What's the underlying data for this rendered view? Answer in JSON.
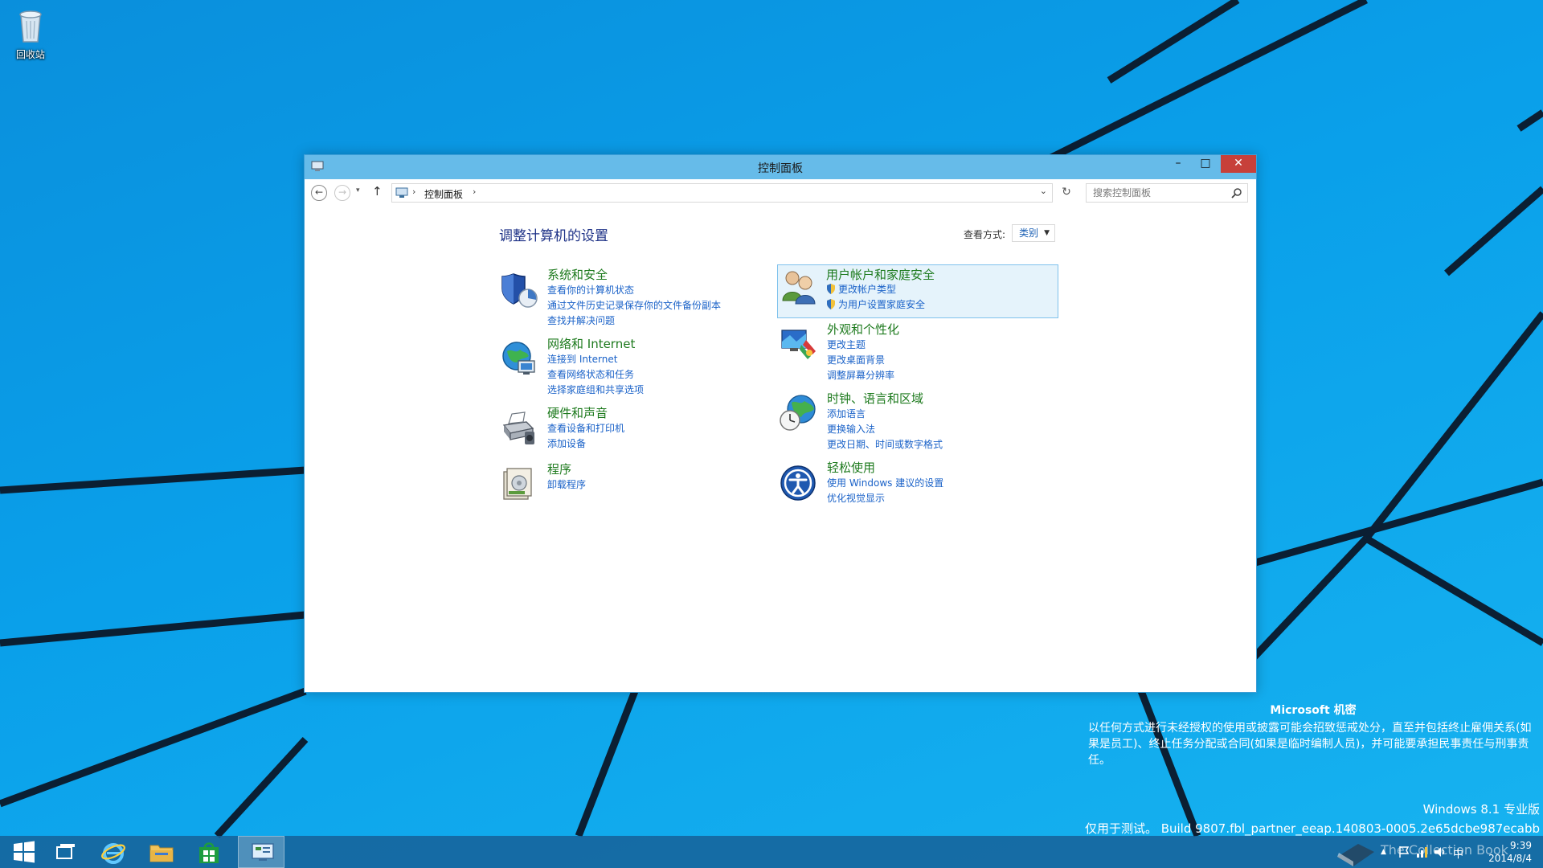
{
  "desktop": {
    "recycle_bin_label": "回收站"
  },
  "window": {
    "title": "控制面板",
    "controls": {
      "minimize": "–",
      "maximize": "□",
      "close": "✕"
    }
  },
  "navbar": {
    "back": "←",
    "forward": "→",
    "recent": "▾",
    "up": "↑",
    "address_crumb": "控制面板",
    "address_separator": "›",
    "dropdown": "⌄",
    "refresh": "↻",
    "search_placeholder": "搜索控制面板"
  },
  "content": {
    "heading": "调整计算机的设置",
    "view_by_label": "查看方式:",
    "view_by_value": "类别",
    "categories": [
      {
        "title": "系统和安全",
        "links": [
          "查看你的计算机状态",
          "通过文件历史记录保存你的文件备份副本",
          "查找并解决问题"
        ]
      },
      {
        "title": "网络和 Internet",
        "links": [
          "连接到 Internet",
          "查看网络状态和任务",
          "选择家庭组和共享选项"
        ]
      },
      {
        "title": "硬件和声音",
        "links": [
          "查看设备和打印机",
          "添加设备"
        ]
      },
      {
        "title": "程序",
        "links": [
          "卸载程序"
        ]
      },
      {
        "title": "用户帐户和家庭安全",
        "links": [
          "更改帐户类型",
          "为用户设置家庭安全"
        ]
      },
      {
        "title": "外观和个性化",
        "links": [
          "更改主题",
          "更改桌面背景",
          "调整屏幕分辨率"
        ]
      },
      {
        "title": "时钟、语言和区域",
        "links": [
          "添加语言",
          "更换输入法",
          "更改日期、时间或数字格式"
        ]
      },
      {
        "title": "轻松使用",
        "links": [
          "使用 Windows 建议的设置",
          "优化视觉显示"
        ]
      }
    ]
  },
  "watermark": {
    "title": "Microsoft 机密",
    "body": "以任何方式进行未经授权的使用或披露可能会招致惩戒处分，直至并包括终止雇佣关系(如果是员工)、终止任务分配或合同(如果是临时编制人员)，并可能要承担民事责任与刑事责任。",
    "edition": "Windows 8.1 专业版",
    "build": "仅用于测试。 Build 9807.fbl_partner_eeap.140803-0005.2e65dcbe987ecabb"
  },
  "taskbar": {
    "tray_up": "▲",
    "tray_ime": "中",
    "clock_time": "9:39",
    "clock_date": "2014/8/4",
    "watermark_logo_text": "The Collection Book"
  },
  "colors": {
    "desktop_blue": "#0a9fe8",
    "titlebar": "#66bbe9",
    "close_button": "#c7403a",
    "category_title": "#1d7a1d",
    "link": "#1a62c8",
    "heading": "#1e3287",
    "highlight_bg": "#e5f3fb",
    "highlight_border": "#7fc2ec"
  }
}
